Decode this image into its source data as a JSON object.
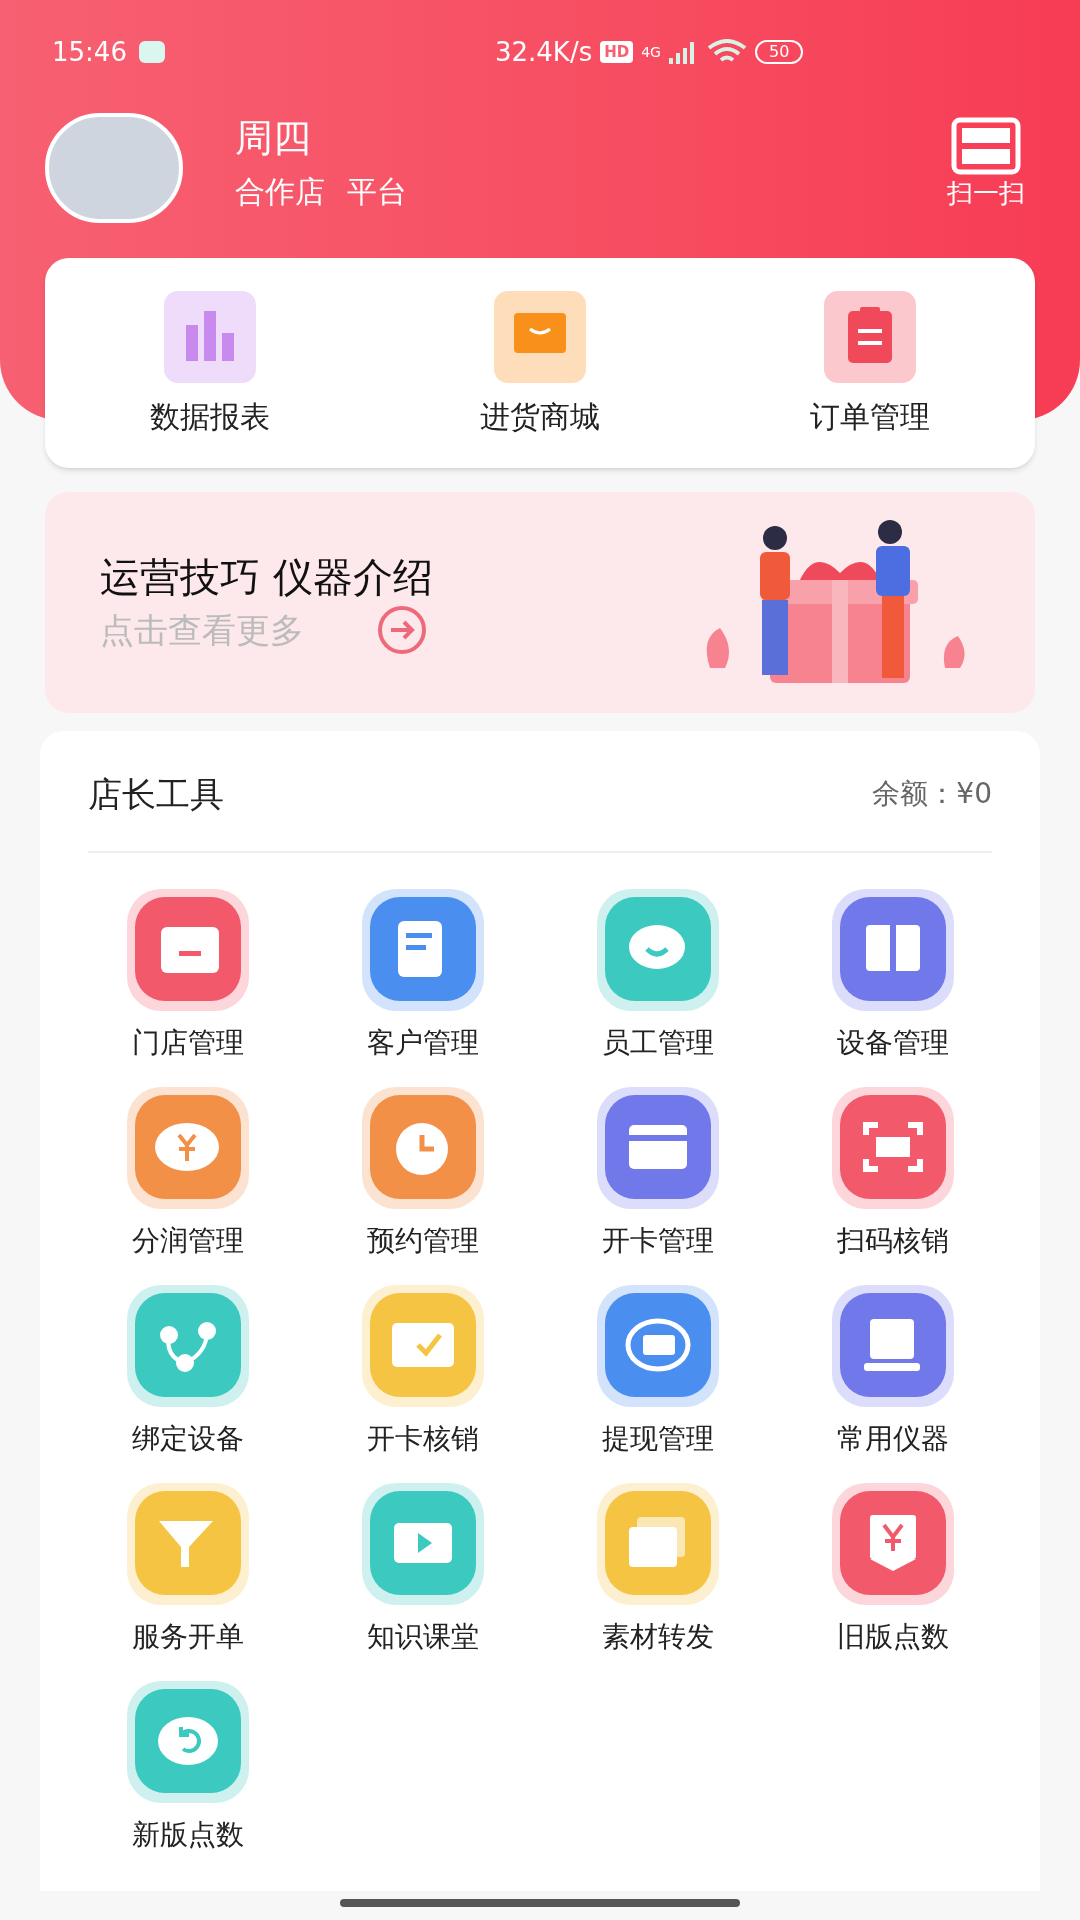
{
  "status_bar": {
    "time": "15:46",
    "speed": "32.4K/s",
    "hd": "HD",
    "network": "4G",
    "battery": "50"
  },
  "header": {
    "name": "周四",
    "tags": [
      "合作店",
      "平台"
    ],
    "scan_label": "扫一扫"
  },
  "quick_actions": [
    {
      "label": "数据报表",
      "color": "#c98af0"
    },
    {
      "label": "进货商城",
      "color": "#f8901a"
    },
    {
      "label": "订单管理",
      "color": "#f04a5a"
    }
  ],
  "banner": {
    "title": "运营技巧 仪器介绍",
    "subtitle": "点击查看更多"
  },
  "tools": {
    "title": "店长工具",
    "balance": "余额：¥0",
    "items": [
      {
        "label": "门店管理",
        "color": "#f25a6b"
      },
      {
        "label": "客户管理",
        "color": "#4a8ff0"
      },
      {
        "label": "员工管理",
        "color": "#3cc9c0"
      },
      {
        "label": "设备管理",
        "color": "#7078ea"
      },
      {
        "label": "分润管理",
        "color": "#f39048"
      },
      {
        "label": "预约管理",
        "color": "#f39048"
      },
      {
        "label": "开卡管理",
        "color": "#7078ea"
      },
      {
        "label": "扫码核销",
        "color": "#f25a6b"
      },
      {
        "label": "绑定设备",
        "color": "#3cc9c0"
      },
      {
        "label": "开卡核销",
        "color": "#f6c443"
      },
      {
        "label": "提现管理",
        "color": "#4a8ff0"
      },
      {
        "label": "常用仪器",
        "color": "#7078ea"
      },
      {
        "label": "服务开单",
        "color": "#f6c443"
      },
      {
        "label": "知识课堂",
        "color": "#3cc9c0"
      },
      {
        "label": "素材转发",
        "color": "#f6c443"
      },
      {
        "label": "旧版点数",
        "color": "#f25a6b"
      },
      {
        "label": "新版点数",
        "color": "#3cc9c0"
      }
    ]
  }
}
